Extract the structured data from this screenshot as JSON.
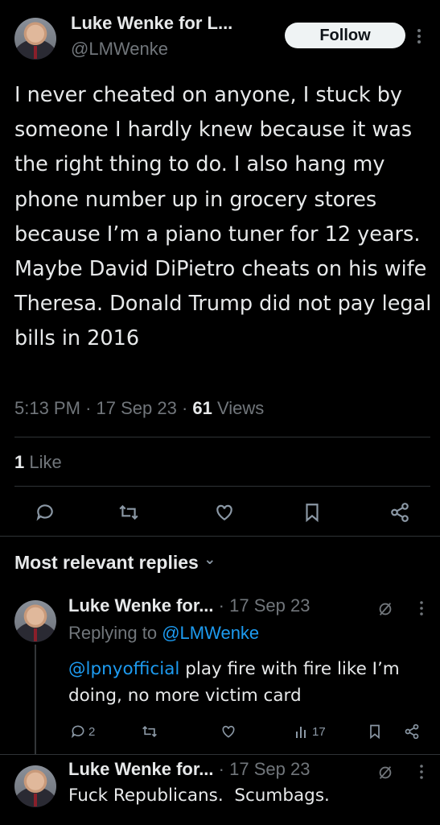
{
  "tweet": {
    "author_name": "Luke Wenke for L...",
    "handle": "@LMWenke",
    "follow_label": "Follow",
    "text": "I never cheated on anyone, I stuck by someone I hardly knew because it was the right thing to do. I also hang my phone number up in grocery stores because I’m a piano tuner for 12 years. Maybe David DiPietro cheats on his wife Theresa. Donald Trump did not pay legal bills in 2016",
    "time": "5:13 PM",
    "sep1": "·",
    "date": "17 Sep 23",
    "sep2": "·",
    "views_count": "61",
    "views_label": "Views",
    "likes_count": "1",
    "likes_label": "Like"
  },
  "replies_header": {
    "label": "Most relevant replies",
    "chevron": "⌄"
  },
  "replies": [
    {
      "author_name": "Luke Wenke for...",
      "sep": "·",
      "date": "17 Sep 23",
      "replying_prefix": "Replying to",
      "replying_to": "@LMWenke",
      "mention": "@lpnyofficial",
      "text": " play fire with fire like I’m doing, no more victim card",
      "reply_count": "2",
      "views_count": "17"
    },
    {
      "author_name": "Luke Wenke for...",
      "sep": "·",
      "date": "17 Sep 23",
      "text": "Fuck Republicans.  Scumbags."
    }
  ],
  "icons": {
    "more": "more-icon",
    "reply": "reply-icon",
    "retweet": "retweet-icon",
    "like": "like-icon",
    "bookmark": "bookmark-icon",
    "share": "share-icon",
    "grok": "slash-icon",
    "views": "views-icon"
  },
  "colors": {
    "background": "#000000",
    "text": "#e7e9ea",
    "muted": "#71767b",
    "link": "#1d9bf0",
    "divider": "#2f3336"
  }
}
